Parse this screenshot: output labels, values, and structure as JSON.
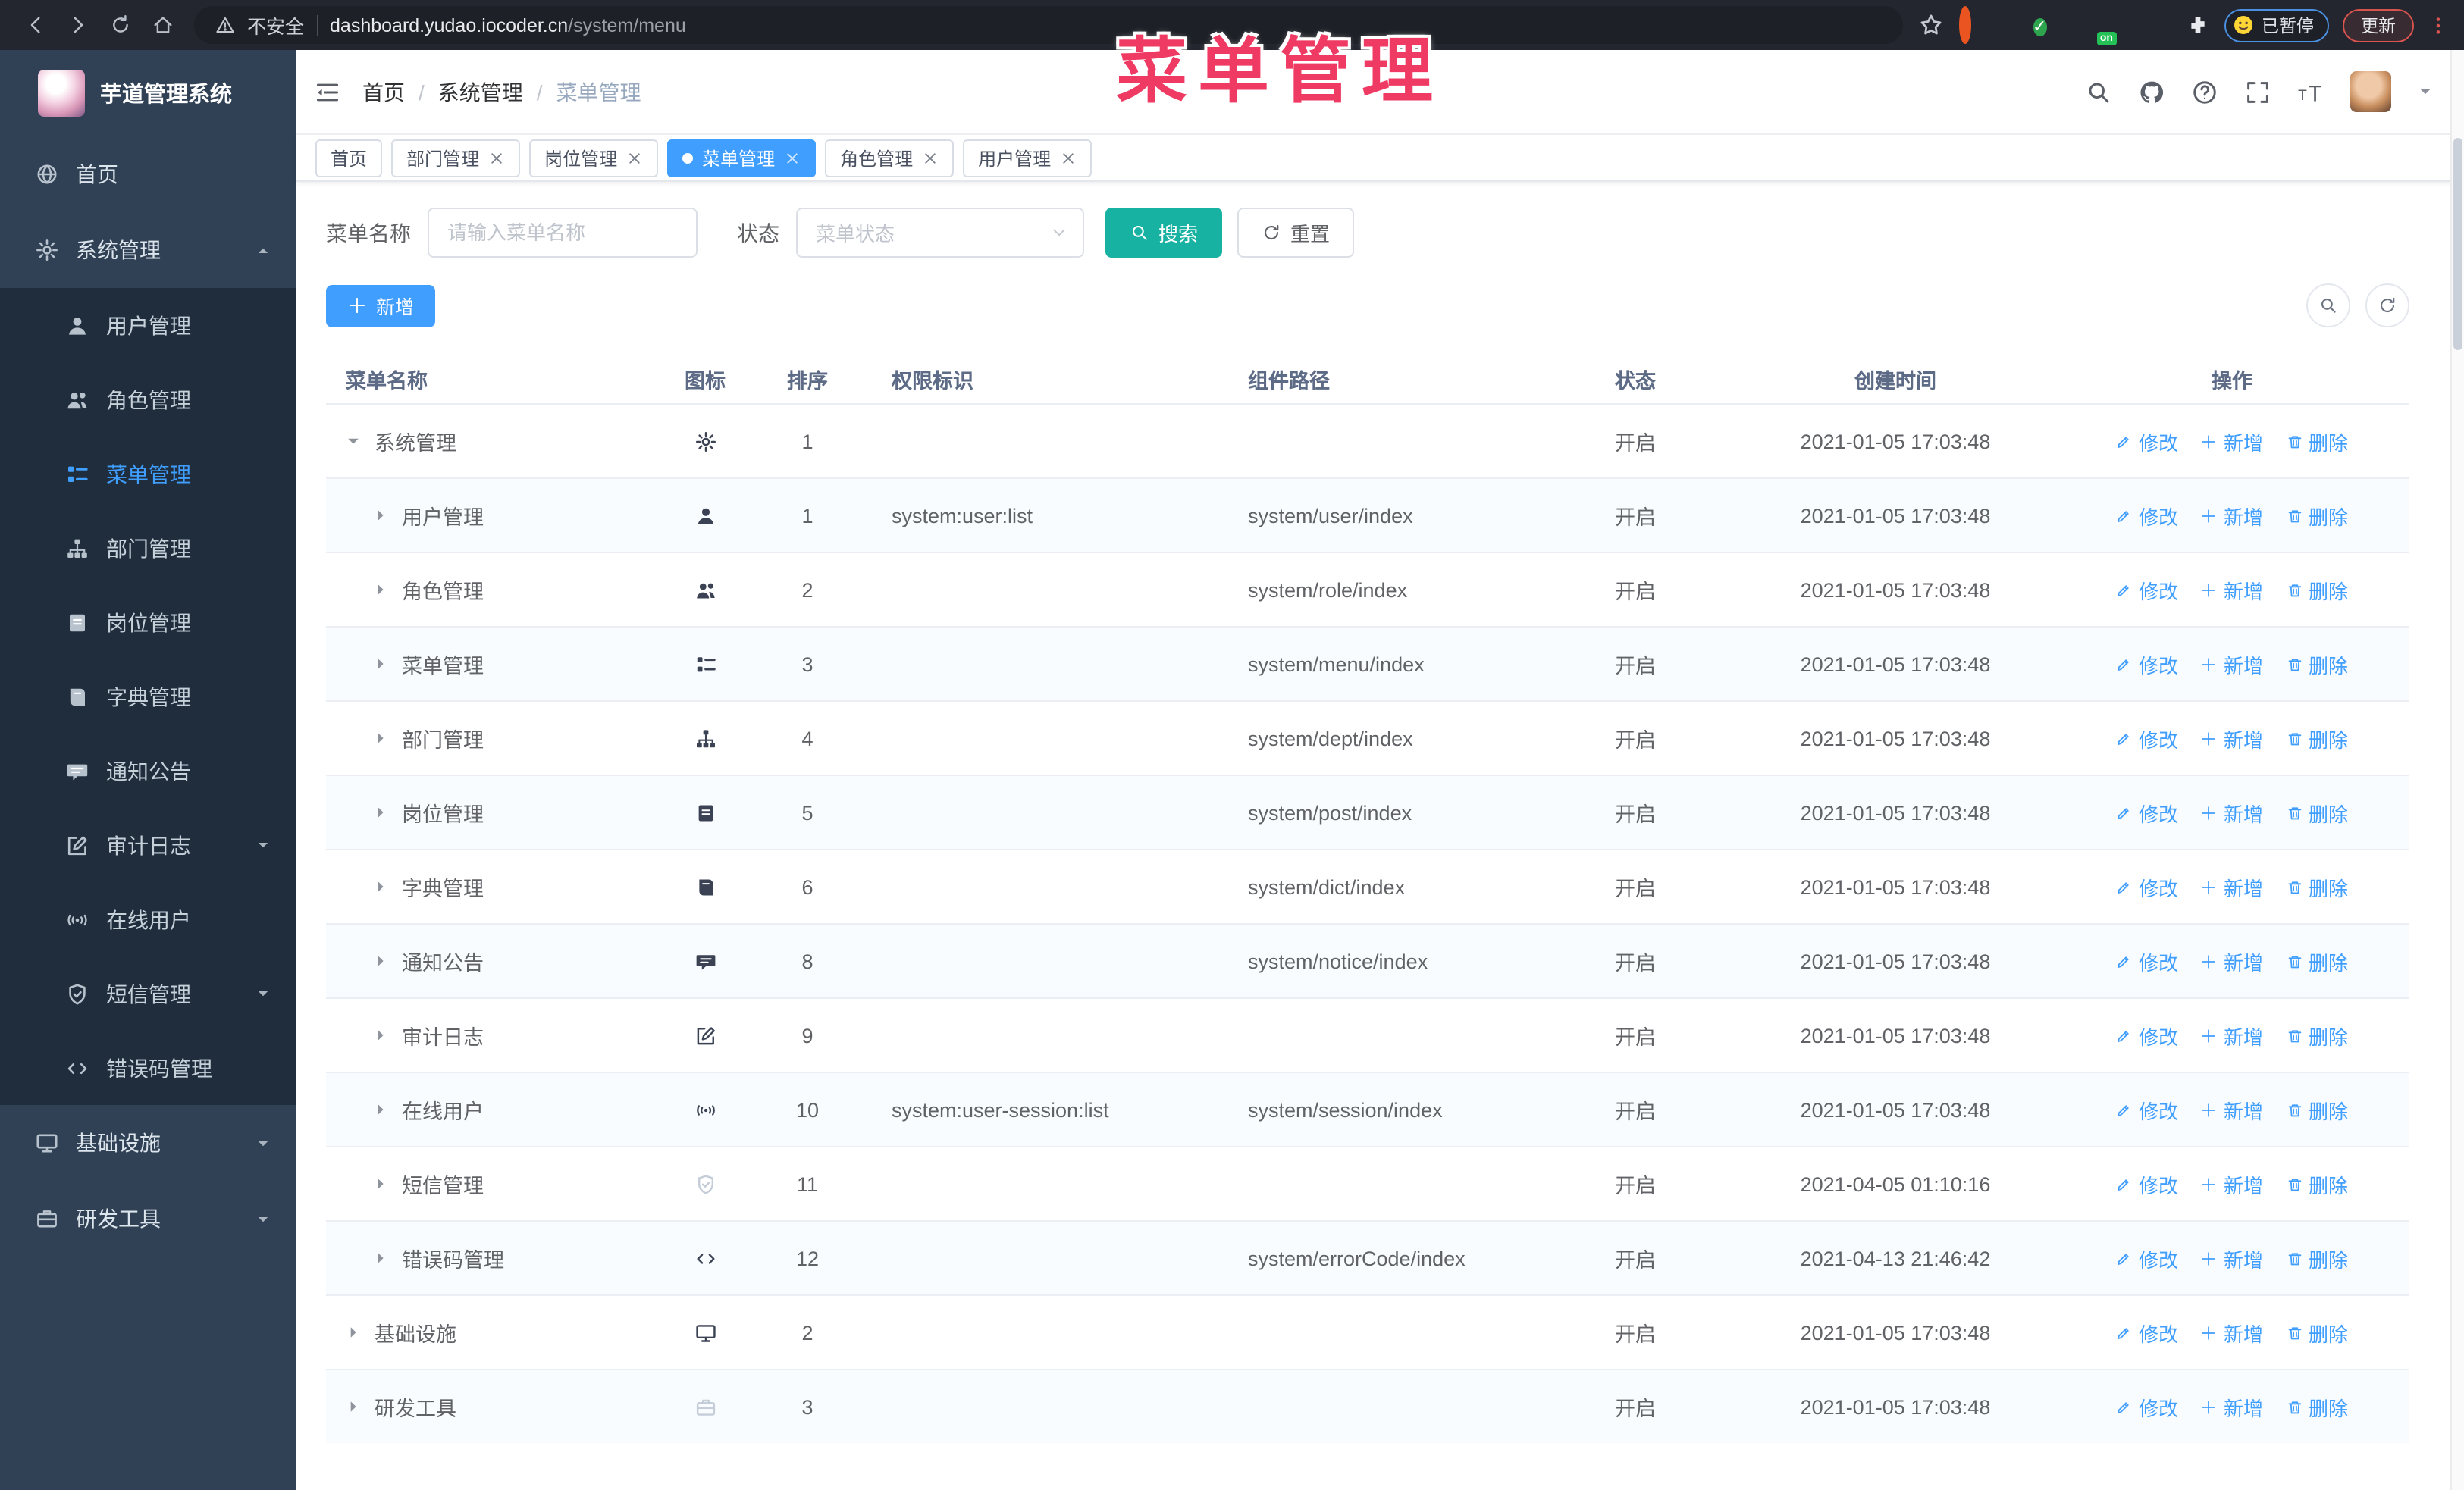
{
  "colors": {
    "primary": "#409eff",
    "teal": "#18b2a2",
    "pink": "#ef3b63",
    "sidebar": "#304156",
    "submenu": "#1f2d3d",
    "link": "#409eff"
  },
  "overlay_title": "菜单管理",
  "browser": {
    "security_label": "不安全",
    "url_host": "dashboard.yudao.iocoder.cn",
    "url_path": "/system/menu",
    "extensions": [
      "orange-ring",
      "blue-gem",
      "green-check",
      "blue-grid",
      "on-badge",
      "green-leaf",
      "puzzle"
    ],
    "paused_label": "已暂停",
    "update_label": "更新"
  },
  "sidebar": {
    "app_title": "芋道管理系统",
    "items": [
      {
        "label": "首页",
        "icon": "globe",
        "type": "top"
      },
      {
        "label": "系统管理",
        "icon": "gear",
        "type": "top",
        "arrow": "up"
      },
      {
        "label": "用户管理",
        "icon": "user",
        "type": "sub"
      },
      {
        "label": "角色管理",
        "icon": "users",
        "type": "sub"
      },
      {
        "label": "菜单管理",
        "icon": "menu",
        "type": "sub",
        "active": true
      },
      {
        "label": "部门管理",
        "icon": "tree",
        "type": "sub"
      },
      {
        "label": "岗位管理",
        "icon": "badge",
        "type": "sub"
      },
      {
        "label": "字典管理",
        "icon": "book",
        "type": "sub"
      },
      {
        "label": "通知公告",
        "icon": "message",
        "type": "sub"
      },
      {
        "label": "审计日志",
        "icon": "edit",
        "type": "sub",
        "arrow": "down"
      },
      {
        "label": "在线用户",
        "icon": "online",
        "type": "sub"
      },
      {
        "label": "短信管理",
        "icon": "shield",
        "type": "sub",
        "arrow": "down"
      },
      {
        "label": "错误码管理",
        "icon": "code",
        "type": "sub"
      },
      {
        "label": "基础设施",
        "icon": "monitor",
        "type": "top",
        "arrow": "down"
      },
      {
        "label": "研发工具",
        "icon": "tool",
        "type": "top",
        "arrow": "down"
      }
    ]
  },
  "header": {
    "breadcrumb": {
      "items": [
        "首页",
        "系统管理",
        "菜单管理"
      ],
      "separator": "/"
    }
  },
  "tabs": [
    {
      "label": "首页",
      "closable": false,
      "active": false
    },
    {
      "label": "部门管理",
      "closable": true,
      "active": false
    },
    {
      "label": "岗位管理",
      "closable": true,
      "active": false
    },
    {
      "label": "菜单管理",
      "closable": true,
      "active": true
    },
    {
      "label": "角色管理",
      "closable": true,
      "active": false
    },
    {
      "label": "用户管理",
      "closable": true,
      "active": false
    }
  ],
  "filters": {
    "name_label": "菜单名称",
    "name_placeholder": "请输入菜单名称",
    "status_label": "状态",
    "status_placeholder": "菜单状态",
    "search_label": "搜索",
    "reset_label": "重置"
  },
  "toolbar": {
    "add_label": "新增"
  },
  "table": {
    "columns": [
      "菜单名称",
      "图标",
      "排序",
      "权限标识",
      "组件路径",
      "状态",
      "创建时间",
      "操作"
    ],
    "actions": {
      "edit": "修改",
      "add": "新增",
      "delete": "删除"
    },
    "rows": [
      {
        "name": "系统管理",
        "level": 1,
        "expanded": true,
        "icon": "gear",
        "sort": "1",
        "perm": "",
        "path": "",
        "status": "开启",
        "time": "2021-01-05 17:03:48"
      },
      {
        "name": "用户管理",
        "level": 2,
        "expanded": false,
        "icon": "user",
        "sort": "1",
        "perm": "system:user:list",
        "path": "system/user/index",
        "status": "开启",
        "time": "2021-01-05 17:03:48"
      },
      {
        "name": "角色管理",
        "level": 2,
        "expanded": false,
        "icon": "users",
        "sort": "2",
        "perm": "",
        "path": "system/role/index",
        "status": "开启",
        "time": "2021-01-05 17:03:48"
      },
      {
        "name": "菜单管理",
        "level": 2,
        "expanded": false,
        "icon": "menu",
        "sort": "3",
        "perm": "",
        "path": "system/menu/index",
        "status": "开启",
        "time": "2021-01-05 17:03:48"
      },
      {
        "name": "部门管理",
        "level": 2,
        "expanded": false,
        "icon": "tree",
        "sort": "4",
        "perm": "",
        "path": "system/dept/index",
        "status": "开启",
        "time": "2021-01-05 17:03:48"
      },
      {
        "name": "岗位管理",
        "level": 2,
        "expanded": false,
        "icon": "badge",
        "sort": "5",
        "perm": "",
        "path": "system/post/index",
        "status": "开启",
        "time": "2021-01-05 17:03:48"
      },
      {
        "name": "字典管理",
        "level": 2,
        "expanded": false,
        "icon": "book",
        "sort": "6",
        "perm": "",
        "path": "system/dict/index",
        "status": "开启",
        "time": "2021-01-05 17:03:48"
      },
      {
        "name": "通知公告",
        "level": 2,
        "expanded": false,
        "icon": "message",
        "sort": "8",
        "perm": "",
        "path": "system/notice/index",
        "status": "开启",
        "time": "2021-01-05 17:03:48"
      },
      {
        "name": "审计日志",
        "level": 2,
        "expanded": false,
        "icon": "edit",
        "sort": "9",
        "perm": "",
        "path": "",
        "status": "开启",
        "time": "2021-01-05 17:03:48"
      },
      {
        "name": "在线用户",
        "level": 2,
        "expanded": false,
        "icon": "online",
        "sort": "10",
        "perm": "system:user-session:list",
        "path": "system/session/index",
        "status": "开启",
        "time": "2021-01-05 17:03:48"
      },
      {
        "name": "短信管理",
        "level": 2,
        "expanded": false,
        "icon": "shield",
        "icon_light": true,
        "sort": "11",
        "perm": "",
        "path": "",
        "status": "开启",
        "time": "2021-04-05 01:10:16"
      },
      {
        "name": "错误码管理",
        "level": 2,
        "expanded": false,
        "icon": "code",
        "sort": "12",
        "perm": "",
        "path": "system/errorCode/index",
        "status": "开启",
        "time": "2021-04-13 21:46:42"
      },
      {
        "name": "基础设施",
        "level": 1,
        "expanded": false,
        "icon": "monitor",
        "sort": "2",
        "perm": "",
        "path": "",
        "status": "开启",
        "time": "2021-01-05 17:03:48"
      },
      {
        "name": "研发工具",
        "level": 1,
        "expanded": false,
        "icon": "tool",
        "icon_light": true,
        "sort": "3",
        "perm": "",
        "path": "",
        "status": "开启",
        "time": "2021-01-05 17:03:48"
      }
    ]
  }
}
